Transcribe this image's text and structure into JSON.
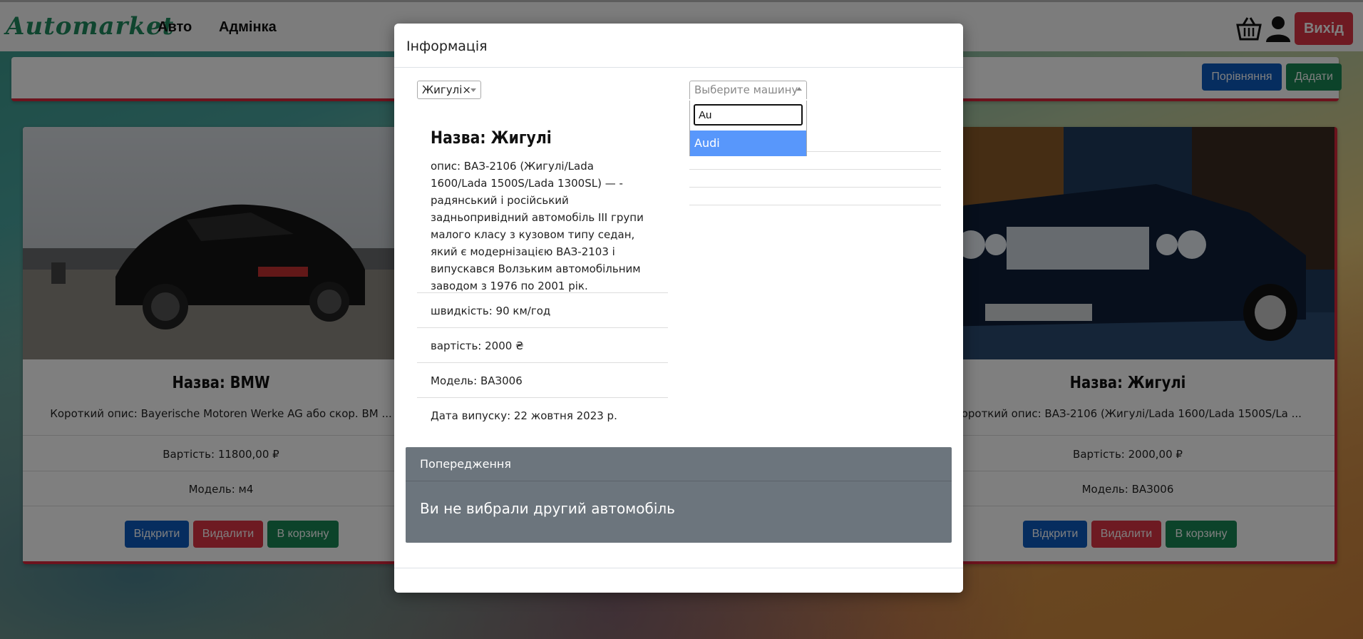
{
  "navbar": {
    "brand": "Automarket",
    "links": [
      "Авто",
      "Адмінка"
    ],
    "exit_label": "Вихід"
  },
  "toolbar": {
    "compare_label": "Порівняння",
    "add_label": "Дадати"
  },
  "cards": [
    {
      "title": "Назва: BMW",
      "desc": "Короткий опис: Bayerische Motoren Werke AG або скор. BM ...",
      "price": "Вартість: 11800,00 ₽",
      "model": "Модель: м4",
      "open": "Відкрити",
      "delete": "Видалити",
      "cart": "В корзину"
    },
    {
      "title": "Назва: Жигулі",
      "desc": "Короткий опис: ВАЗ-2106 (Жигулі/Lada 1600/Lada 1500S/La ...",
      "price": "Вартість: 2000,00 ₽",
      "model": "Модель: ВАЗ006",
      "open": "Відкрити",
      "delete": "Видалити",
      "cart": "В корзину"
    }
  ],
  "modal": {
    "title": "Інформація",
    "left_select": "Жигулі",
    "right_select_placeholder": "Выберите машину",
    "search_value": "Au",
    "option": "Audi",
    "car_title": "Назва: Жигулі",
    "car_desc": "опис: ВАЗ-2106 (Жигулі/Lada 1600/Lada 1500S/Lada 1300SL) — - радянський і російський задньопривідний автомобіль III групи малого класу з кузовом типу седан, який є модернізацією ВАЗ-2103 і випускався Волзьким автомобільним заводом з 1976 по 2001 рік.",
    "speed": "швидкість: 90 км/год",
    "cost": "вартість: 2000 ₴",
    "model": "Модель: ВАЗ006",
    "date": "Дата випуску: 22 жовтня 2023 р.",
    "alert_head": "Попередження",
    "alert_body": "Ви не вибрали другий автомобіль"
  },
  "colors": {
    "primary": "#0d5bbf",
    "success": "#198754",
    "danger": "#dc3545",
    "alert_bg": "#6c757d",
    "highlight": "#5897fb"
  }
}
